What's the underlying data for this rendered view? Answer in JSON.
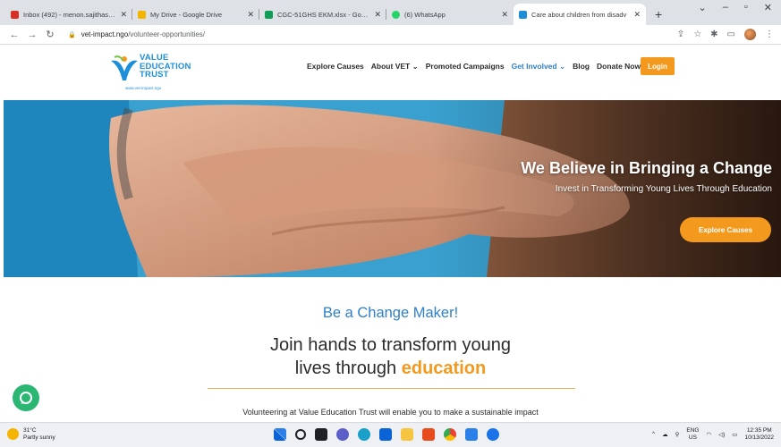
{
  "browser": {
    "tabs": [
      {
        "title": "Inbox (492) - menon.sajithas@g",
        "favicon_color": "#d93025",
        "icon": "gmail-icon"
      },
      {
        "title": "My Drive - Google Drive",
        "favicon_color": "#f4b400",
        "icon": "drive-icon"
      },
      {
        "title": "CGC-51GHS EKM.xlsx - Google Sh",
        "favicon_color": "#0f9d58",
        "icon": "sheets-icon"
      },
      {
        "title": "(6) WhatsApp",
        "favicon_color": "#25d366",
        "icon": "whatsapp-icon"
      },
      {
        "title": "Care about children from disadv",
        "favicon_color": "#1d8fd8",
        "icon": "vet-icon",
        "active": true
      }
    ],
    "url_host": "vet-impact.ngo",
    "url_path": "/volunteer-opportunities/"
  },
  "site": {
    "logo": {
      "line1": "VALUE",
      "line2": "EDUCATION",
      "line3": "TRUST",
      "url": "www.vet-impact.ngo"
    },
    "nav": [
      {
        "label": "Explore Causes",
        "dropdown": false
      },
      {
        "label": "About VET",
        "dropdown": true
      },
      {
        "label": "Promoted Campaigns",
        "dropdown": false
      },
      {
        "label": "Get Involved",
        "dropdown": true,
        "active": true
      },
      {
        "label": "Blog",
        "dropdown": false
      },
      {
        "label": "Donate Now",
        "dropdown": false
      }
    ],
    "login_label": "Login",
    "hero": {
      "title": "We Believe in Bringing a Change",
      "subtitle": "Invest in Transforming Young Lives Through Education",
      "button_label": "Explore Causes"
    },
    "tagline": "Be a Change Maker!",
    "headline_line1": "Join hands to transform young",
    "headline_line2": "lives through",
    "headline_accent": "education",
    "intro": "Volunteering at Value Education Trust will enable you to make a sustainable impact"
  },
  "colors": {
    "brand_blue": "#2f80c9",
    "brand_orange": "#f39a1e",
    "chat_green": "#2bb673"
  },
  "taskbar": {
    "weather_temp": "31°C",
    "weather_desc": "Partly sunny",
    "lang_line1": "ENG",
    "lang_line2": "US",
    "time": "12:35 PM",
    "date": "10/13/2022"
  }
}
